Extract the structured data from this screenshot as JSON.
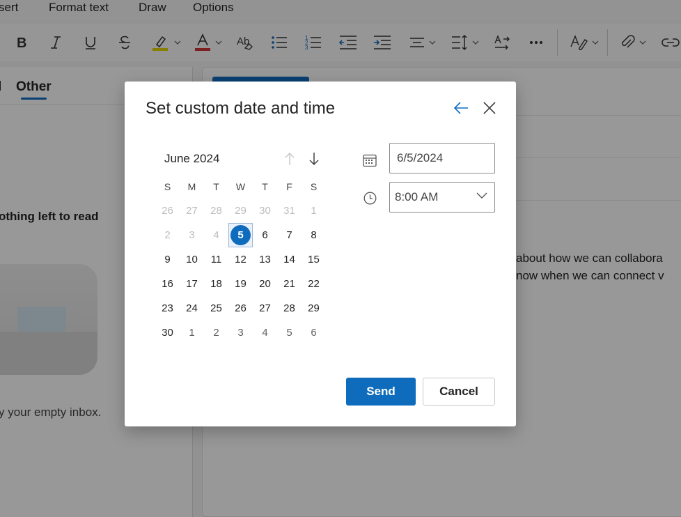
{
  "menubar": {
    "items": [
      "sert",
      "Format text",
      "Draw",
      "Options"
    ]
  },
  "mail_list": {
    "tab_partial": "l",
    "tab_other": "Other",
    "nothing_text": "othing left to read",
    "empty_text": "y your empty inbox."
  },
  "compose": {
    "line1": "about how we can collabora",
    "line2": "now when we can connect v"
  },
  "dialog": {
    "title": "Set custom date and time",
    "month_label": "June 2024",
    "weekdays": [
      "S",
      "M",
      "T",
      "W",
      "T",
      "F",
      "S"
    ],
    "weeks": [
      [
        "26",
        "27",
        "28",
        "29",
        "30",
        "31",
        "1"
      ],
      [
        "2",
        "3",
        "4",
        "5",
        "6",
        "7",
        "8"
      ],
      [
        "9",
        "10",
        "11",
        "12",
        "13",
        "14",
        "15"
      ],
      [
        "16",
        "17",
        "18",
        "19",
        "20",
        "21",
        "22"
      ],
      [
        "23",
        "24",
        "25",
        "26",
        "27",
        "28",
        "29"
      ],
      [
        "30",
        "1",
        "2",
        "3",
        "4",
        "5",
        "6"
      ]
    ],
    "selected_day": "5",
    "date_value": "6/5/2024",
    "time_value": "8:00 AM",
    "send_label": "Send",
    "cancel_label": "Cancel"
  },
  "colors": {
    "accent": "#0f6cbd",
    "highlight_yellow": "#e3d400",
    "font_red": "#d13438"
  }
}
